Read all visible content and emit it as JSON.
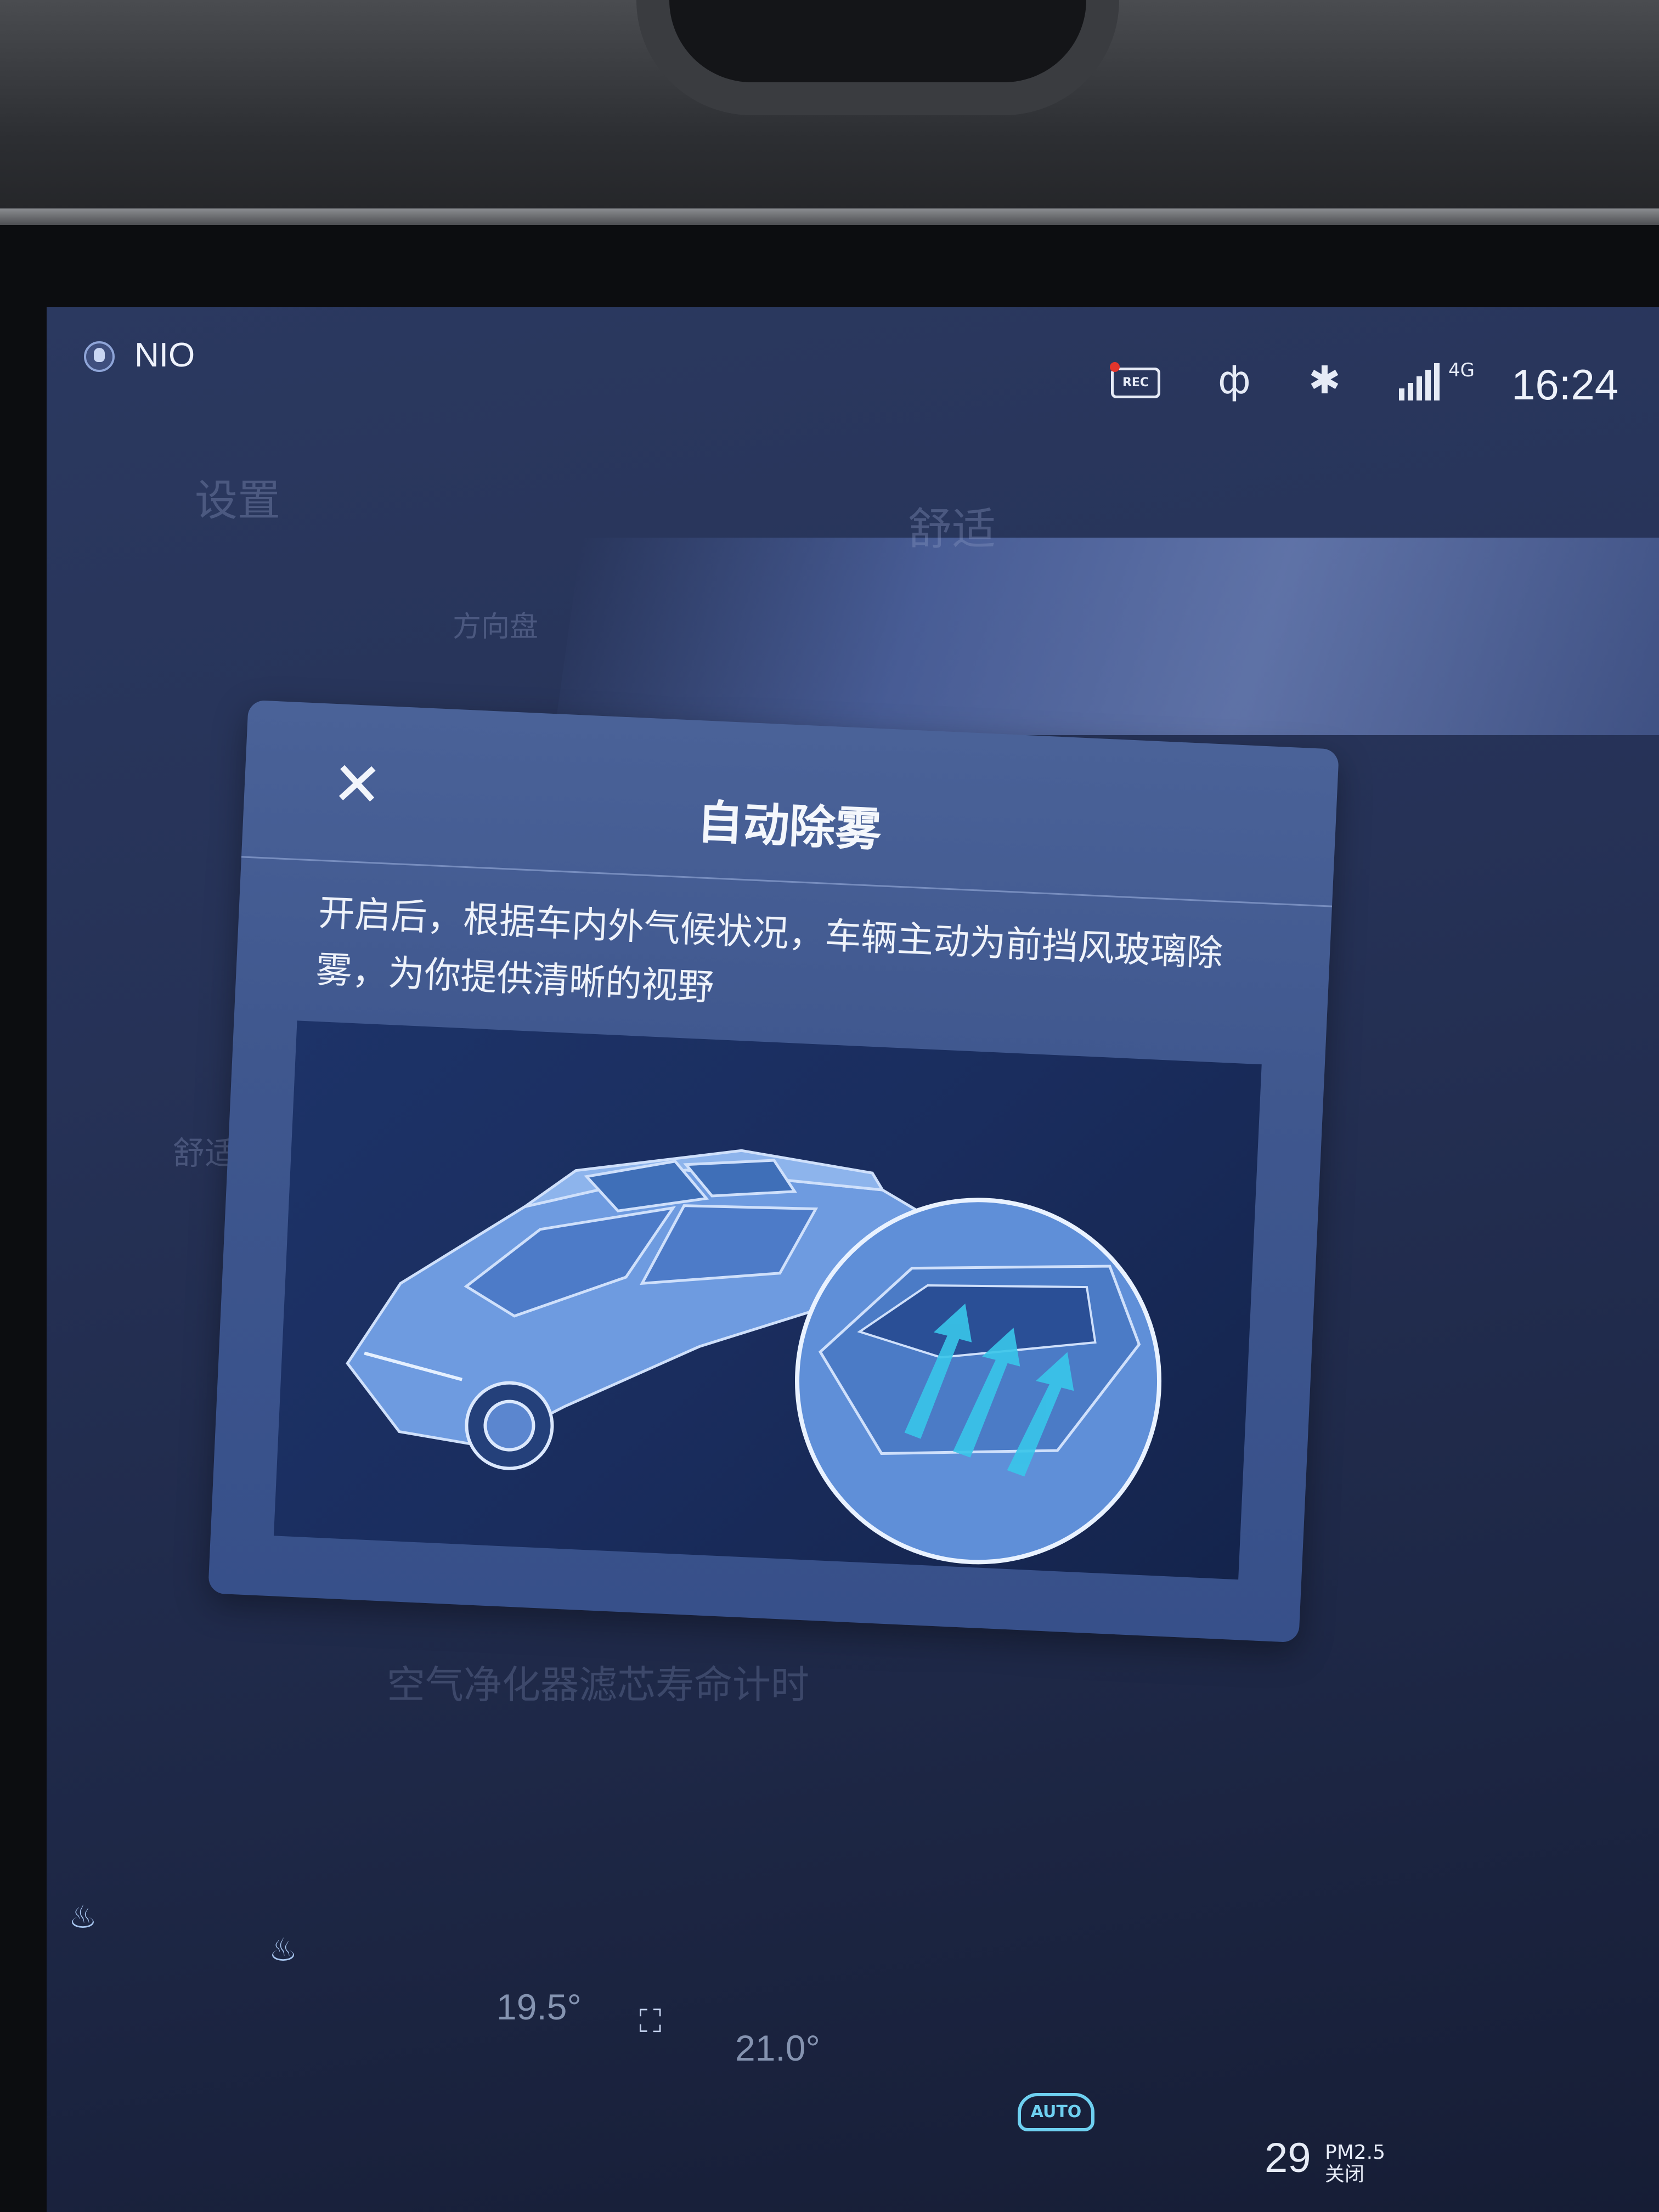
{
  "status_bar": {
    "brand": "NIO",
    "rec_label": "REC",
    "network": "4G",
    "time": "16:24"
  },
  "background_page": {
    "title": "设置",
    "section": "舒适",
    "steering_label": "方向盘",
    "nav_comfort": "舒适",
    "filter_label": "空气净化器滤芯寿命计时"
  },
  "modal": {
    "title": "自动除雾",
    "description": "开启后，根据车内外气候状况，车辆主动为前挡风玻璃除雾，为你提供清晰的视野",
    "close_icon": "close-icon"
  },
  "climate_bar": {
    "driver_temp": "19.5°",
    "passenger_temp": "21.0°",
    "auto_label": "AUTO",
    "aqi_value": "29",
    "aqi_label": "PM2.5",
    "aqi_status": "关闭"
  },
  "colors": {
    "accent": "#6ed0f0",
    "modal_bg": "#4a6298",
    "screen_bg": "#263257"
  }
}
